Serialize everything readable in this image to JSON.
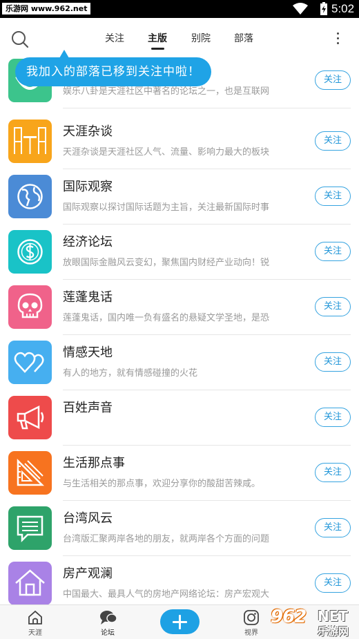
{
  "status_bar": {
    "watermark": "乐游网 www.962.net",
    "time": "5:02"
  },
  "header": {
    "tabs": [
      {
        "label": "关注",
        "active": false
      },
      {
        "label": "主版",
        "active": true
      },
      {
        "label": "别院",
        "active": false
      },
      {
        "label": "部落",
        "active": false
      }
    ]
  },
  "tooltip": {
    "text": "我加入的部落已移到关注中啦！"
  },
  "forums": [
    {
      "title": "",
      "desc": "娱乐八卦是天涯社区中著名的论坛之一，也是互联网",
      "follow": "关注",
      "icon": "gossip-icon",
      "color": "#3cc48c"
    },
    {
      "title": "天涯杂谈",
      "desc": "天涯杂谈是天涯社区人气、流量、影响力最大的板块",
      "follow": "关注",
      "icon": "chairs-table-icon",
      "color": "#f8a51b"
    },
    {
      "title": "国际观察",
      "desc": "国际观察以探讨国际话题为主旨，关注最新国际时事",
      "follow": "关注",
      "icon": "globe-icon",
      "color": "#4b8bd6"
    },
    {
      "title": "经济论坛",
      "desc": "放眼国际金融风云变幻，聚焦国内财经产业动向！锐",
      "follow": "关注",
      "icon": "dollar-coin-icon",
      "color": "#19c3c7"
    },
    {
      "title": "莲蓬鬼话",
      "desc": "莲蓬鬼话，国内唯一负有盛名的悬疑文学圣地，是恐",
      "follow": "关注",
      "icon": "skull-icon",
      "color": "#f0628a"
    },
    {
      "title": "情感天地",
      "desc": "有人的地方，就有情感碰撞的火花",
      "follow": "关注",
      "icon": "hearts-icon",
      "color": "#46aff0"
    },
    {
      "title": "百姓声音",
      "desc": "",
      "follow": "关注",
      "icon": "megaphone-icon",
      "color": "#ee4b4b"
    },
    {
      "title": "生活那点事",
      "desc": "与生活相关的那点事，欢迎分享你的酸甜苦辣咸。",
      "follow": "关注",
      "icon": "ruler-triangle-icon",
      "color": "#f7731f"
    },
    {
      "title": "台湾风云",
      "desc": "台湾版汇聚两岸各地的朋友，就两岸各个方面的问题",
      "follow": "关注",
      "icon": "chat-board-icon",
      "color": "#2ea36a"
    },
    {
      "title": "房产观澜",
      "desc": "中国最大、最具人气的房地产网络论坛：房产宏观大",
      "follow": "关注",
      "icon": "house-icon",
      "color": "#a982e6"
    }
  ],
  "bottom_nav": {
    "items": [
      {
        "label": "天涯",
        "icon": "home-icon"
      },
      {
        "label": "论坛",
        "icon": "chat-bubbles-icon",
        "active": true
      },
      {
        "label": "",
        "icon": "plus-icon"
      },
      {
        "label": "视界",
        "icon": "camera-icon"
      }
    ]
  },
  "watermark": {
    "brand": "962",
    "net": "NET",
    "sub": "乐游网"
  }
}
